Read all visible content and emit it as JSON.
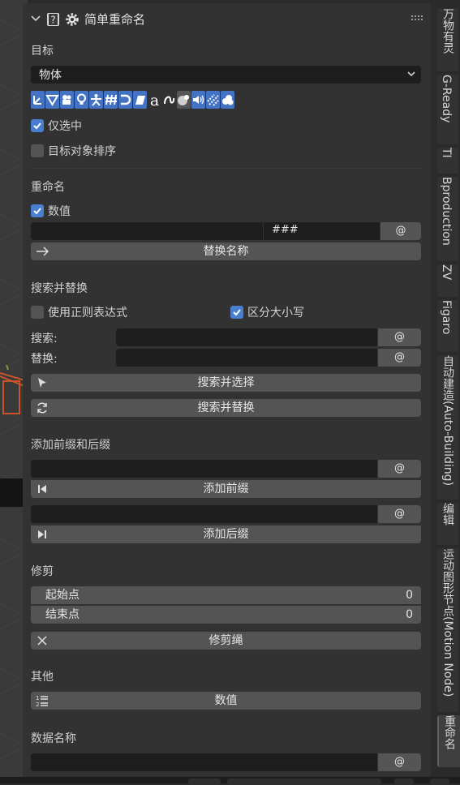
{
  "panel": {
    "title": "简单重命名",
    "target_label": "目标",
    "target_value": "物体",
    "selected_only_label": "仅选中",
    "selected_only_checked": true,
    "sort_label": "目标对象排序",
    "sort_checked": false
  },
  "rename": {
    "heading": "重命名",
    "numeric_label": "数值",
    "numeric_checked": true,
    "name_value": "",
    "number_pattern": "###",
    "at_label": "@",
    "replace_btn": "替换名称"
  },
  "search": {
    "heading": "搜索并替换",
    "regex_label": "使用正则表达式",
    "regex_checked": false,
    "case_label": "区分大小写",
    "case_checked": true,
    "search_label": "搜索:",
    "replace_label": "替换:",
    "search_value": "",
    "replace_value": "",
    "at_label": "@",
    "select_btn": "搜索并选择",
    "replace_btn": "搜索并替换"
  },
  "affix": {
    "heading": "添加前缀和后缀",
    "at_label": "@",
    "prefix_btn": "添加前缀",
    "suffix_btn": "添加后缀"
  },
  "trim": {
    "heading": "修剪",
    "start_label": "起始点",
    "start_value": "0",
    "end_label": "结束点",
    "end_value": "0",
    "trim_btn": "修剪绳"
  },
  "other": {
    "heading": "其他",
    "numeric_btn": "数值"
  },
  "data_name": {
    "heading": "数据名称",
    "at_label": "@"
  },
  "tabs": [
    "万物有灵",
    "G-Ready",
    "TI",
    "Bproduction",
    "ZV",
    "Figaro",
    "自动建造(Auto-Building)",
    "编辑",
    "运动图形节点(Motion Node)",
    "重命名"
  ],
  "colors": {
    "accent": "#4473c4",
    "checkbox_on": "#4a7fd0",
    "panel_bg": "#323232",
    "field_bg": "#1e1e1e",
    "button_bg": "#545454"
  }
}
